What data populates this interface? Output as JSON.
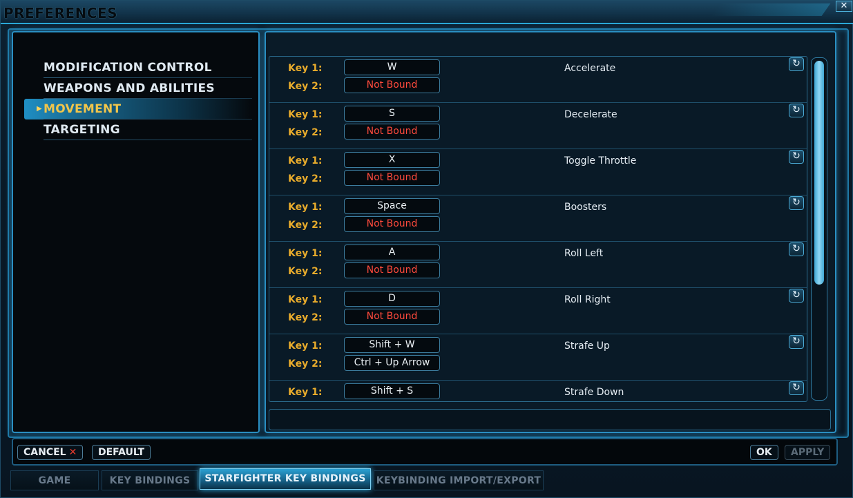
{
  "window": {
    "title": "PREFERENCES",
    "close_label": "✕"
  },
  "categories": [
    {
      "label": "MODIFICATION CONTROL",
      "active": false
    },
    {
      "label": "WEAPONS AND ABILITIES",
      "active": false
    },
    {
      "label": "MOVEMENT",
      "active": true
    },
    {
      "label": "TARGETING",
      "active": false
    }
  ],
  "bindings": {
    "key1_label": "Key 1:",
    "key2_label": "Key 2:",
    "reset_icon": "↻",
    "rows": [
      {
        "action": "Accelerate",
        "key1": "W",
        "key2": "Not Bound",
        "key2_unbound": true
      },
      {
        "action": "Decelerate",
        "key1": "S",
        "key2": "Not Bound",
        "key2_unbound": true
      },
      {
        "action": "Toggle Throttle",
        "key1": "X",
        "key2": "Not Bound",
        "key2_unbound": true
      },
      {
        "action": "Boosters",
        "key1": "Space",
        "key2": "Not Bound",
        "key2_unbound": true
      },
      {
        "action": "Roll Left",
        "key1": "A",
        "key2": "Not Bound",
        "key2_unbound": true
      },
      {
        "action": "Roll Right",
        "key1": "D",
        "key2": "Not Bound",
        "key2_unbound": true
      },
      {
        "action": "Strafe Up",
        "key1": "Shift + W",
        "key2": "Ctrl + Up Arrow",
        "key2_unbound": false
      },
      {
        "action": "Strafe Down",
        "key1": "Shift + S",
        "key2": "",
        "key2_unbound": false
      }
    ]
  },
  "buttons": {
    "cancel": "CANCEL",
    "cancel_icon": "✕",
    "default": "DEFAULT",
    "ok": "OK",
    "apply": "APPLY"
  },
  "tabs": [
    {
      "label": "GAME"
    },
    {
      "label": "KEY BINDINGS"
    },
    {
      "label": "STARFIGHTER KEY BINDINGS"
    },
    {
      "label": "KEYBINDING IMPORT/EXPORT"
    }
  ],
  "colors": {
    "accent": "#2a8fc2",
    "key_label": "#e9ac2c",
    "unbound": "#ff4a3c",
    "active_category": "#f1c54b"
  }
}
